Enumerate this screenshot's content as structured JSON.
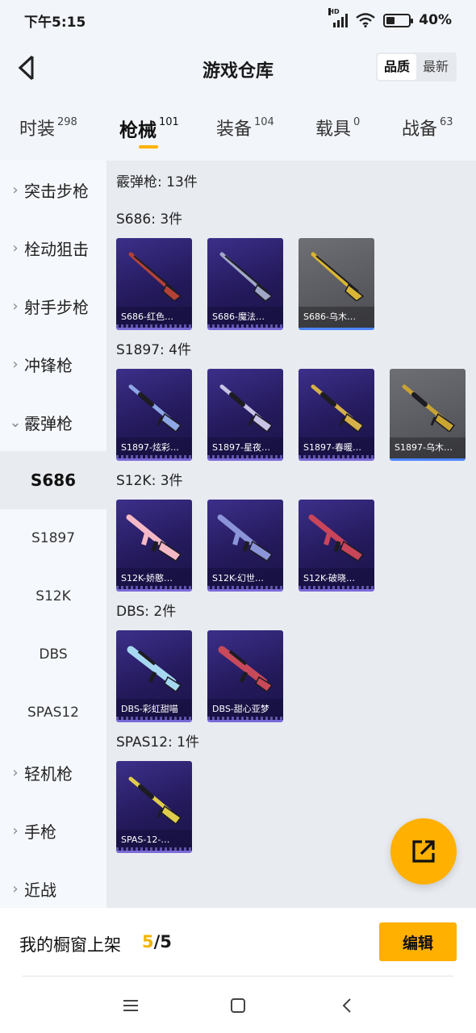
{
  "status": {
    "time": "下午5:15",
    "battery": "40%",
    "battery_level": 0.4,
    "network": "HD"
  },
  "header": {
    "title": "游戏仓库",
    "sort_options": [
      "品质",
      "最新"
    ],
    "sort_active": "品质"
  },
  "tabs": [
    {
      "label": "时装",
      "count": "298"
    },
    {
      "label": "枪械",
      "count": "101",
      "active": true
    },
    {
      "label": "装备",
      "count": "104"
    },
    {
      "label": "载具",
      "count": "0"
    },
    {
      "label": "战备",
      "count": "63"
    }
  ],
  "sidebar": {
    "categories": [
      {
        "label": "突击步枪",
        "chev": "›"
      },
      {
        "label": "栓动狙击",
        "chev": "›"
      },
      {
        "label": "射手步枪",
        "chev": "›"
      },
      {
        "label": "冲锋枪",
        "chev": "›"
      },
      {
        "label": "霰弹枪",
        "chev": "⌄"
      },
      {
        "label": "轻机枪",
        "chev": "›"
      },
      {
        "label": "手枪",
        "chev": "›"
      },
      {
        "label": "近战",
        "chev": "›"
      }
    ],
    "subs": [
      "S686",
      "S1897",
      "S12K",
      "DBS",
      "SPAS12"
    ],
    "active_sub": "S686"
  },
  "content": {
    "total": "霰弹枪: 13件",
    "groups": [
      {
        "title": "S686: 3件",
        "items": [
          {
            "name": "S686-红色…",
            "style": "purple",
            "gun": "double",
            "color": "#b2413a"
          },
          {
            "name": "S686-魔法…",
            "style": "purple",
            "gun": "double",
            "color": "#9fa6c6"
          },
          {
            "name": "S686-乌木…",
            "style": "gray",
            "gun": "double",
            "color": "#d8b534"
          }
        ]
      },
      {
        "title": "S1897: 4件",
        "items": [
          {
            "name": "S1897-炫彩…",
            "style": "purple",
            "gun": "pump",
            "color": "#8ea7e6"
          },
          {
            "name": "S1897-星夜…",
            "style": "purple",
            "gun": "pump",
            "color": "#c9c3e6"
          },
          {
            "name": "S1897-春暖…",
            "style": "purple",
            "gun": "pump",
            "color": "#d6b04a"
          },
          {
            "name": "S1897-乌木…",
            "style": "gray",
            "gun": "pump",
            "color": "#c9a431"
          }
        ]
      },
      {
        "title": "S12K: 3件",
        "items": [
          {
            "name": "S12K-娇憨…",
            "style": "purple",
            "gun": "rifle",
            "color": "#f4b9c6"
          },
          {
            "name": "S12K-幻世…",
            "style": "purple",
            "gun": "rifle",
            "color": "#8b94d8"
          },
          {
            "name": "S12K-破晓…",
            "style": "purple",
            "gun": "rifle",
            "color": "#c8455a"
          }
        ]
      },
      {
        "title": "DBS: 2件",
        "items": [
          {
            "name": "DBS-彩虹甜喵",
            "style": "purple",
            "gun": "bullpup",
            "color": "#a7d8f2"
          },
          {
            "name": "DBS-甜心亚梦",
            "style": "purple",
            "gun": "bullpup",
            "color": "#c84a5a"
          }
        ]
      },
      {
        "title": "SPAS12: 1件",
        "items": [
          {
            "name": "SPAS-12-…",
            "style": "purple",
            "gun": "pump",
            "color": "#e0cc4c"
          }
        ]
      }
    ]
  },
  "bottom": {
    "showcase_label": "我的橱窗上架",
    "showcase_current": "5",
    "showcase_total": "/5",
    "edit_label": "编辑"
  },
  "icons": {
    "back": "back-arrow-icon",
    "fab": "share-icon",
    "nav": [
      "menu-icon",
      "home-icon",
      "back-icon"
    ]
  }
}
